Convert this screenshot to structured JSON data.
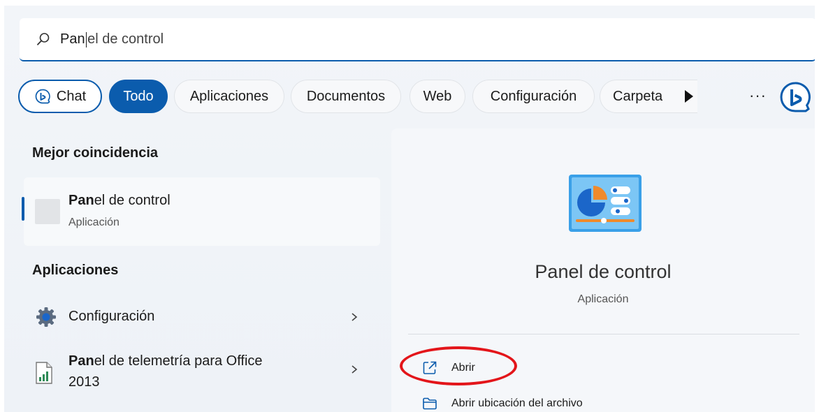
{
  "search": {
    "query_typed": "Pan",
    "query_rest": "el de control"
  },
  "filters": {
    "chat": "Chat",
    "todo": "Todo",
    "aplicaciones": "Aplicaciones",
    "documentos": "Documentos",
    "web": "Web",
    "configuracion": "Configuración",
    "carpetas": "Carpeta",
    "more": "···"
  },
  "best_match": {
    "heading": "Mejor coincidencia",
    "name_bold": "Pan",
    "name_rest": "el de control",
    "type": "Aplicación"
  },
  "apps": {
    "heading": "Aplicaciones",
    "items": [
      {
        "label": "Configuración"
      },
      {
        "label_bold": "Pan",
        "label_rest": "el de telemetría para Office",
        "label_line2": "2013"
      }
    ]
  },
  "detail": {
    "title": "Panel de control",
    "subtitle": "Aplicación",
    "actions": [
      {
        "label": "Abrir"
      },
      {
        "label": "Abrir ubicación del archivo"
      }
    ]
  },
  "colors": {
    "accent": "#0b5cad",
    "highlight": "#e3151a"
  }
}
